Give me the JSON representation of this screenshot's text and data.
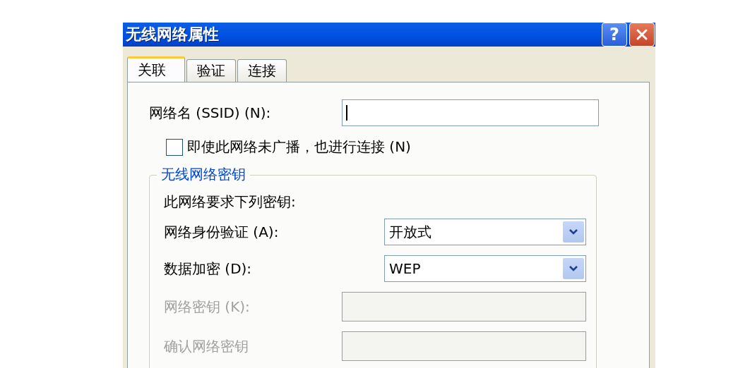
{
  "window": {
    "title": "无线网络属性",
    "help_button": "?"
  },
  "tabs": [
    {
      "label": "关联",
      "selected": true
    },
    {
      "label": "验证",
      "selected": false
    },
    {
      "label": "连接",
      "selected": false
    }
  ],
  "ssid": {
    "label": "网络名 (SSID) (N):",
    "focused": true
  },
  "broadcast_checkbox": {
    "label": "即使此网络未广播，也进行连接 (N)",
    "checked": false
  },
  "key_group": {
    "title": "无线网络密钥",
    "note": "此网络要求下列密钥:",
    "fields": [
      {
        "kind": "select",
        "label": "网络身份验证 (A):",
        "value": "开放式",
        "disabled": false
      },
      {
        "kind": "select",
        "label": "数据加密 (D):",
        "value": "WEP",
        "disabled": false
      },
      {
        "kind": "input",
        "label": "网络密钥 (K):",
        "disabled": true
      },
      {
        "kind": "input",
        "label": "确认网络密钥",
        "disabled": true
      }
    ]
  }
}
